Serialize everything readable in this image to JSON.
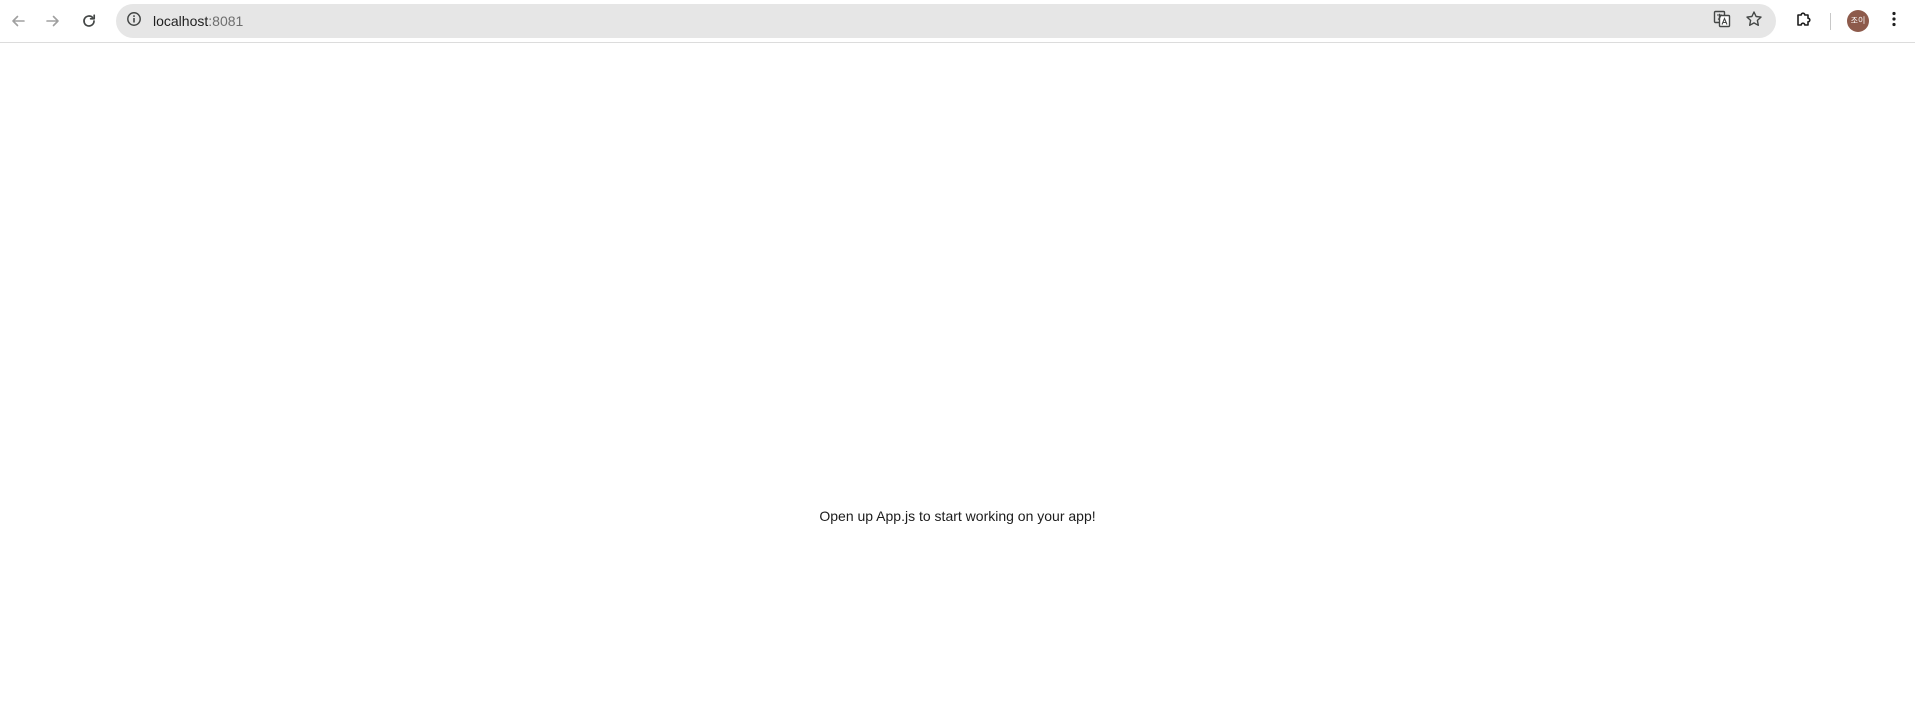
{
  "browser": {
    "url_host": "localhost",
    "url_port": ":8081",
    "avatar_initials": "조이",
    "colors": {
      "omnibox_bg": "#e6e6e6",
      "avatar_bg": "#8d5a4b",
      "icon_color": "#444746"
    },
    "icons": [
      "back-arrow-icon",
      "forward-arrow-icon",
      "reload-icon",
      "site-info-icon",
      "translate-icon",
      "bookmark-star-icon",
      "extensions-puzzle-icon",
      "kebab-menu-icon"
    ]
  },
  "page": {
    "message": "Open up App.js to start working on your app!"
  }
}
